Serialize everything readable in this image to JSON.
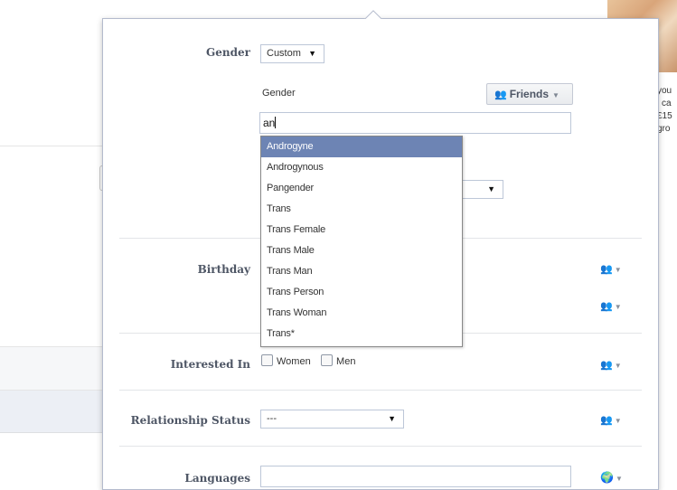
{
  "background": {
    "side_text": [
      "you",
      "l ca",
      "£15",
      "gro"
    ]
  },
  "fields": {
    "gender": {
      "label": "Gender",
      "select_value": "Custom",
      "sub_label": "Gender",
      "audience_label": "Friends",
      "input_value": "an"
    },
    "birthday": {
      "label": "Birthday"
    },
    "interested_in": {
      "label": "Interested In",
      "options": [
        "Women",
        "Men"
      ]
    },
    "relationship_status": {
      "label": "Relationship Status",
      "select_value": "---"
    },
    "languages": {
      "label": "Languages",
      "input_value": ""
    }
  },
  "autocomplete": {
    "items": [
      "Androgyne",
      "Androgynous",
      "Pangender",
      "Trans",
      "Trans Female",
      "Trans Male",
      "Trans Man",
      "Trans Person",
      "Trans Woman",
      "Trans*"
    ],
    "highlighted_index": 0
  },
  "icons": {
    "audience": "friends-icon",
    "public": "globe-icon",
    "dropdown": "chevron-down-icon"
  }
}
